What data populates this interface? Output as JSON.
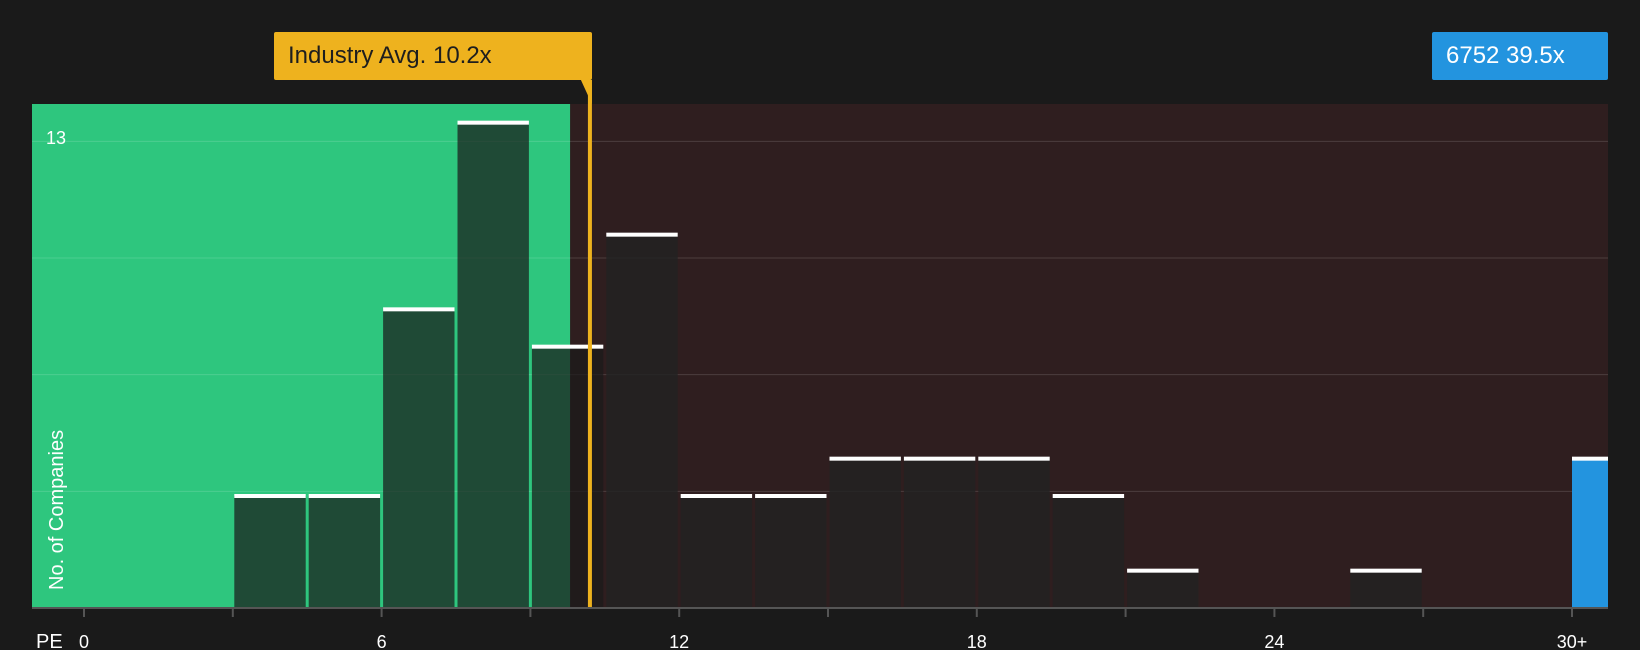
{
  "chart_data": {
    "type": "bar",
    "xlabel": "PE",
    "ylabel": "No. of Companies",
    "x_tick_labels": [
      "0",
      "6",
      "12",
      "18",
      "24",
      "30+"
    ],
    "x_ticks": [
      0,
      6,
      12,
      18,
      24,
      30
    ],
    "xlim": [
      -1,
      30.8
    ],
    "y_top_label": "13",
    "ylim": [
      0,
      13.5
    ],
    "bins": [
      {
        "x0": 3,
        "x1": 4.5,
        "value": 3
      },
      {
        "x0": 4.5,
        "x1": 6,
        "value": 3
      },
      {
        "x0": 6,
        "x1": 7.5,
        "value": 8
      },
      {
        "x0": 7.5,
        "x1": 9,
        "value": 13
      },
      {
        "x0": 9,
        "x1": 10.5,
        "value": 7
      },
      {
        "x0": 10.5,
        "x1": 12,
        "value": 10
      },
      {
        "x0": 12,
        "x1": 13.5,
        "value": 3
      },
      {
        "x0": 13.5,
        "x1": 15,
        "value": 3
      },
      {
        "x0": 15,
        "x1": 16.5,
        "value": 4
      },
      {
        "x0": 16.5,
        "x1": 18,
        "value": 4
      },
      {
        "x0": 18,
        "x1": 19.5,
        "value": 4
      },
      {
        "x0": 19.5,
        "x1": 21,
        "value": 3
      },
      {
        "x0": 21,
        "x1": 22.5,
        "value": 1
      },
      {
        "x0": 25.5,
        "x1": 27,
        "value": 1
      }
    ],
    "company_bar": {
      "x0": 30,
      "value": 4
    },
    "industry_avg": {
      "label": "Industry Avg. 10.2x",
      "value": 10.2
    },
    "company": {
      "label": "6752 39.5x",
      "value": 39.5
    },
    "shaded_below_x": 9.8,
    "colors": {
      "below_zone": "#2ec67e",
      "above_zone": "#2f1e1f",
      "bar": "#1f1f1f",
      "bar_edge": "#ffffff",
      "industry": "#eeb21e",
      "company": "#2394df",
      "background": "#1a1a1a"
    }
  }
}
